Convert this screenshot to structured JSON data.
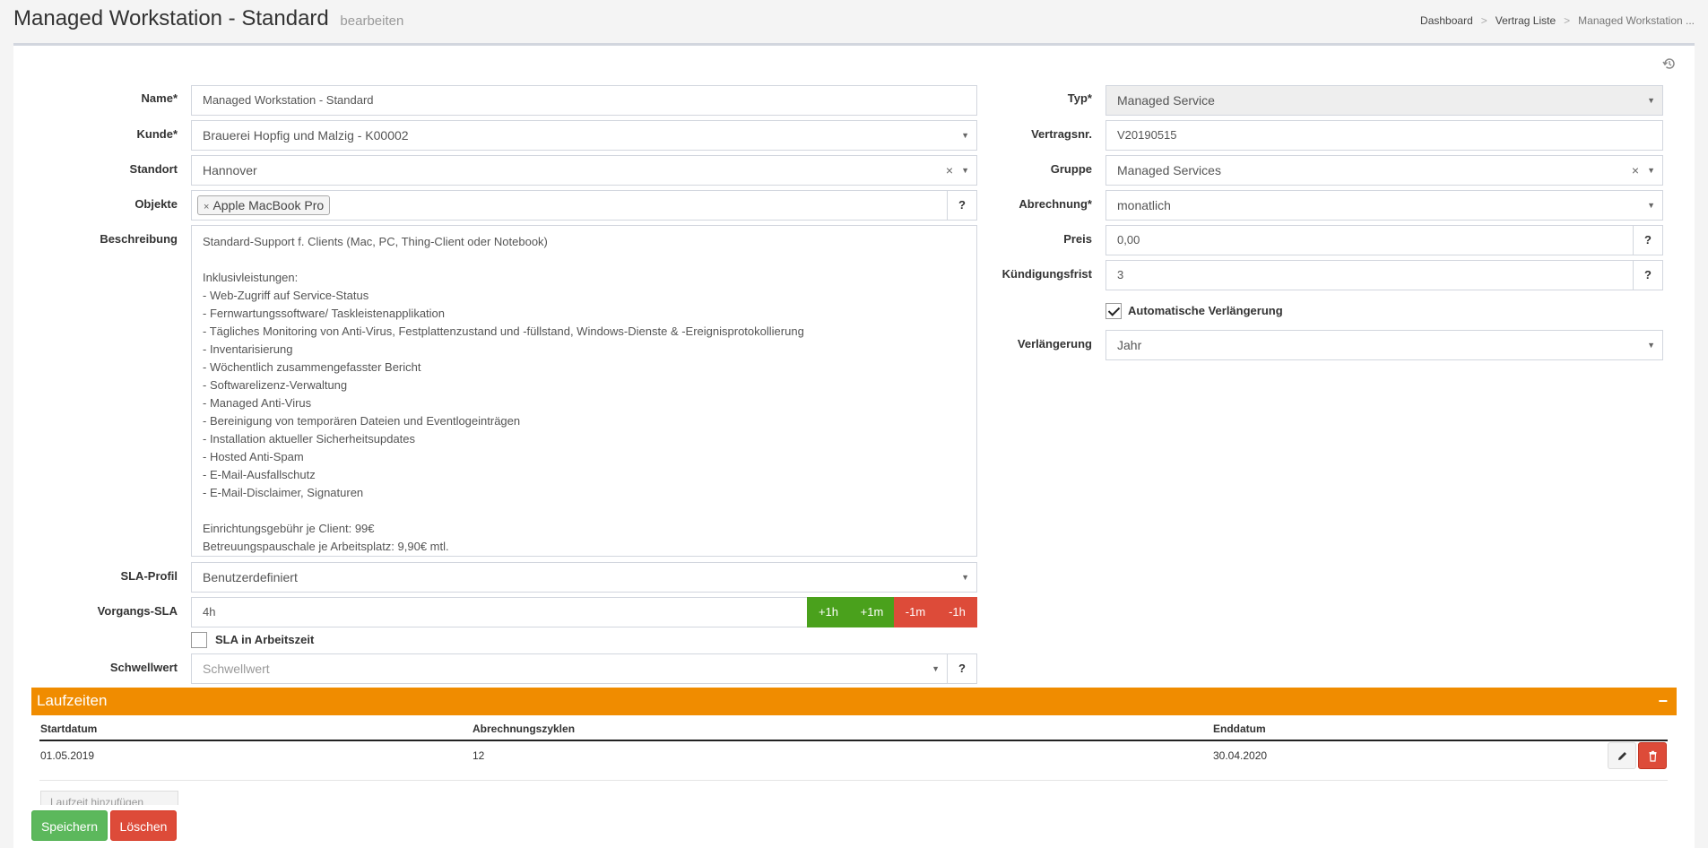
{
  "header": {
    "title": "Managed Workstation - Standard",
    "subtitle": "bearbeiten",
    "breadcrumb": [
      "Dashboard",
      "Vertrag Liste",
      "Managed Workstation ..."
    ]
  },
  "form_left": {
    "name": {
      "label": "Name*",
      "value": "Managed Workstation - Standard"
    },
    "kunde": {
      "label": "Kunde*",
      "value": "Brauerei Hopfig und Malzig - K00002"
    },
    "standort": {
      "label": "Standort",
      "value": "Hannover"
    },
    "objekte": {
      "label": "Objekte",
      "tag": "Apple MacBook Pro",
      "help": "?"
    },
    "beschreibung": {
      "label": "Beschreibung",
      "lines": [
        "Standard-Support f. Clients (Mac, PC, Thing-Client oder Notebook)",
        "",
        "Inklusivleistungen:",
        "- Web-Zugriff auf Service-Status",
        "- Fernwartungssoftware/ Taskleistenapplikation",
        "- Tägliches Monitoring von Anti-Virus, Festplattenzustand und -füllstand, Windows-Dienste & -Ereignisprotokollierung",
        "- Inventarisierung",
        "- Wöchentlich zusammengefasster Bericht",
        "- Softwarelizenz-Verwaltung",
        "- Managed Anti-Virus",
        "- Bereinigung von temporären Dateien und Eventlogeinträgen",
        "- Installation aktueller Sicherheitsupdates",
        "- Hosted Anti-Spam",
        "- E-Mail-Ausfallschutz",
        "- E-Mail-Disclaimer, Signaturen",
        "",
        "Einrichtungsgebühr je Client: 99€",
        "Betreuungspauschale je Arbeitsplatz: 9,90€ mtl."
      ]
    },
    "sla_profil": {
      "label": "SLA-Profil",
      "value": "Benutzerdefiniert"
    },
    "vorgangs_sla": {
      "label": "Vorgangs-SLA",
      "value": "4h",
      "buttons": [
        "+1h",
        "+1m",
        "-1m",
        "-1h"
      ]
    },
    "sla_arbeitszeit": {
      "label": "SLA in Arbeitszeit"
    },
    "schwellwert": {
      "label": "Schwellwert",
      "placeholder": "Schwellwert",
      "help": "?"
    }
  },
  "form_right": {
    "typ": {
      "label": "Typ*",
      "value": "Managed Service"
    },
    "vertragsnr": {
      "label": "Vertragsnr.",
      "value": "V20190515"
    },
    "gruppe": {
      "label": "Gruppe",
      "value": "Managed Services"
    },
    "abrechnung": {
      "label": "Abrechnung*",
      "value": "monatlich"
    },
    "preis": {
      "label": "Preis",
      "value": "0,00",
      "help": "?"
    },
    "kuendigungsfrist": {
      "label": "Kündigungsfrist",
      "value": "3",
      "help": "?"
    },
    "auto_verlaengerung": {
      "label": "Automatische Verlängerung"
    },
    "verlaengerung": {
      "label": "Verlängerung",
      "value": "Jahr"
    }
  },
  "laufzeiten": {
    "title": "Laufzeiten",
    "collapse": "−",
    "columns": [
      "Startdatum",
      "Abrechnungszyklen",
      "Enddatum"
    ],
    "rows": [
      {
        "start": "01.05.2019",
        "zyklen": "12",
        "ende": "30.04.2020"
      }
    ],
    "add_label": "Laufzeit hinzufügen"
  },
  "actions": {
    "save": "Speichern",
    "delete": "Löschen"
  },
  "colors": {
    "accent_orange": "#f08c00",
    "green": "#4aa11c",
    "red": "#dd4b39"
  }
}
